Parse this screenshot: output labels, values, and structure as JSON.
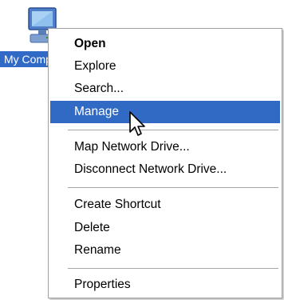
{
  "desktop": {
    "icon_label": "My Computer",
    "icon_name": "my-computer-icon"
  },
  "menu": {
    "items": [
      {
        "label": "Open",
        "bold": true
      },
      {
        "label": "Explore"
      },
      {
        "label": "Search..."
      },
      {
        "label": "Manage",
        "highlighted": true
      },
      {
        "label": "Map Network Drive..."
      },
      {
        "label": "Disconnect Network Drive..."
      },
      {
        "label": "Create Shortcut"
      },
      {
        "label": "Delete"
      },
      {
        "label": "Rename"
      },
      {
        "label": "Properties"
      }
    ]
  },
  "colors": {
    "highlight": "#316ac5",
    "selection_label": "#3169c6"
  },
  "cursor": {
    "icon": "arrow-pointer-icon"
  }
}
